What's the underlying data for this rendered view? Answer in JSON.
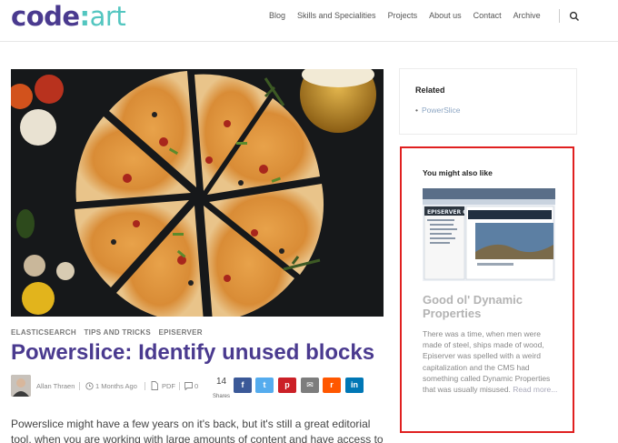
{
  "header": {
    "logo": {
      "part1": "code",
      "part2": ":",
      "part3": "art"
    },
    "nav": [
      "Blog",
      "Skills and Specialities",
      "Projects",
      "About us",
      "Contact",
      "Archive"
    ],
    "search_icon": "search-icon"
  },
  "article": {
    "categories": [
      "ELASTICSEARCH",
      "TIPS AND TRICKS",
      "EPISERVER"
    ],
    "title": "Powerslice: Identify unused blocks",
    "author": "Allan Thraen",
    "date": "1 Months Ago",
    "pdf_label": "PDF",
    "comments": "0",
    "shares_count": "14",
    "shares_label": "Shares",
    "share_buttons": [
      {
        "name": "facebook",
        "glyph": "f",
        "color": "#3b5998"
      },
      {
        "name": "twitter",
        "glyph": "t",
        "color": "#55acee"
      },
      {
        "name": "pinterest",
        "glyph": "p",
        "color": "#cb2027"
      },
      {
        "name": "email",
        "glyph": "✉",
        "color": "#7d7d7d"
      },
      {
        "name": "reddit",
        "glyph": "r",
        "color": "#ff5700"
      },
      {
        "name": "linkedin",
        "glyph": "in",
        "color": "#0077b5"
      }
    ],
    "excerpt": "Powerslice might have a few years on it's back, but it's still a great editorial tool, when you are working with large amounts of content and have access to"
  },
  "sidebar": {
    "related_heading": "Related",
    "related_item": "PowerSlice",
    "also_heading": "You might also like",
    "also_title": "Good ol' Dynamic Properties",
    "also_excerpt": "There was a time, when men were made of steel, ships made of wood, Episerver was spelled with a weird capitalization and the CMS had something called Dynamic Properties that was usually misused.",
    "also_more": "Read more...",
    "thumb_text": "EPISERVER CMS"
  }
}
